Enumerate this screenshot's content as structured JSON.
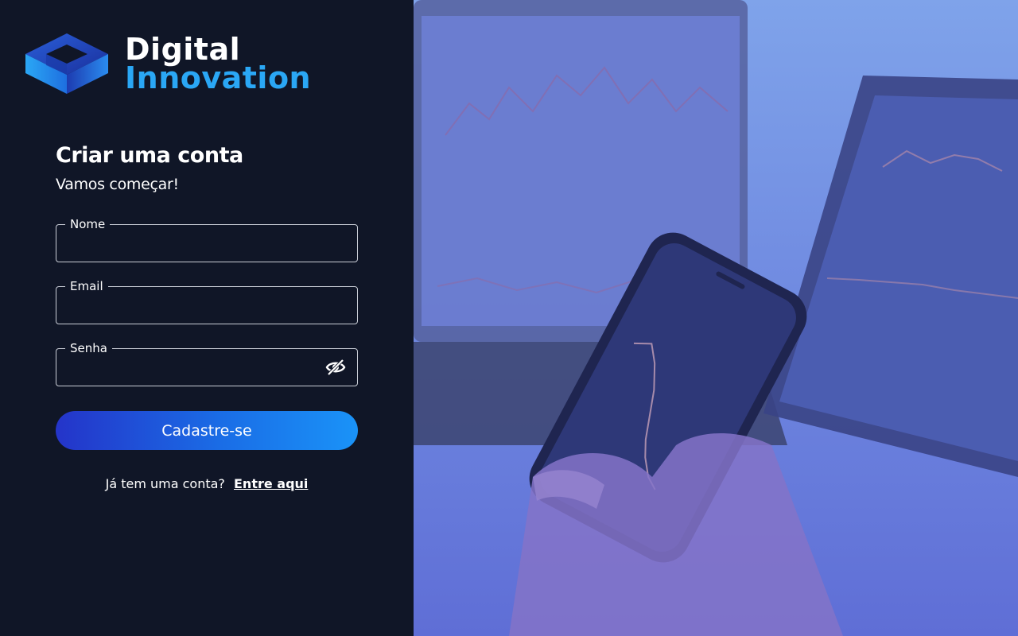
{
  "brand": {
    "line1": "Digital",
    "line2": "Innovation",
    "line2_color": "#2aa7f5"
  },
  "form": {
    "title": "Criar uma conta",
    "subtitle": "Vamos começar!",
    "fields": [
      {
        "label": "Nome",
        "value": "",
        "type": "text"
      },
      {
        "label": "Email",
        "value": "",
        "type": "email"
      },
      {
        "label": "Senha",
        "value": "",
        "type": "password",
        "icon": "eye-off-icon"
      }
    ],
    "submit_label": "Cadastre-se",
    "signin_prompt": "Já tem uma conta?",
    "signin_link": "Entre aqui"
  },
  "colors": {
    "background": "#101627",
    "button_gradient_start": "#2434c9",
    "button_gradient_end": "#1a93f8",
    "image_overlay": "#5a6fd2"
  }
}
